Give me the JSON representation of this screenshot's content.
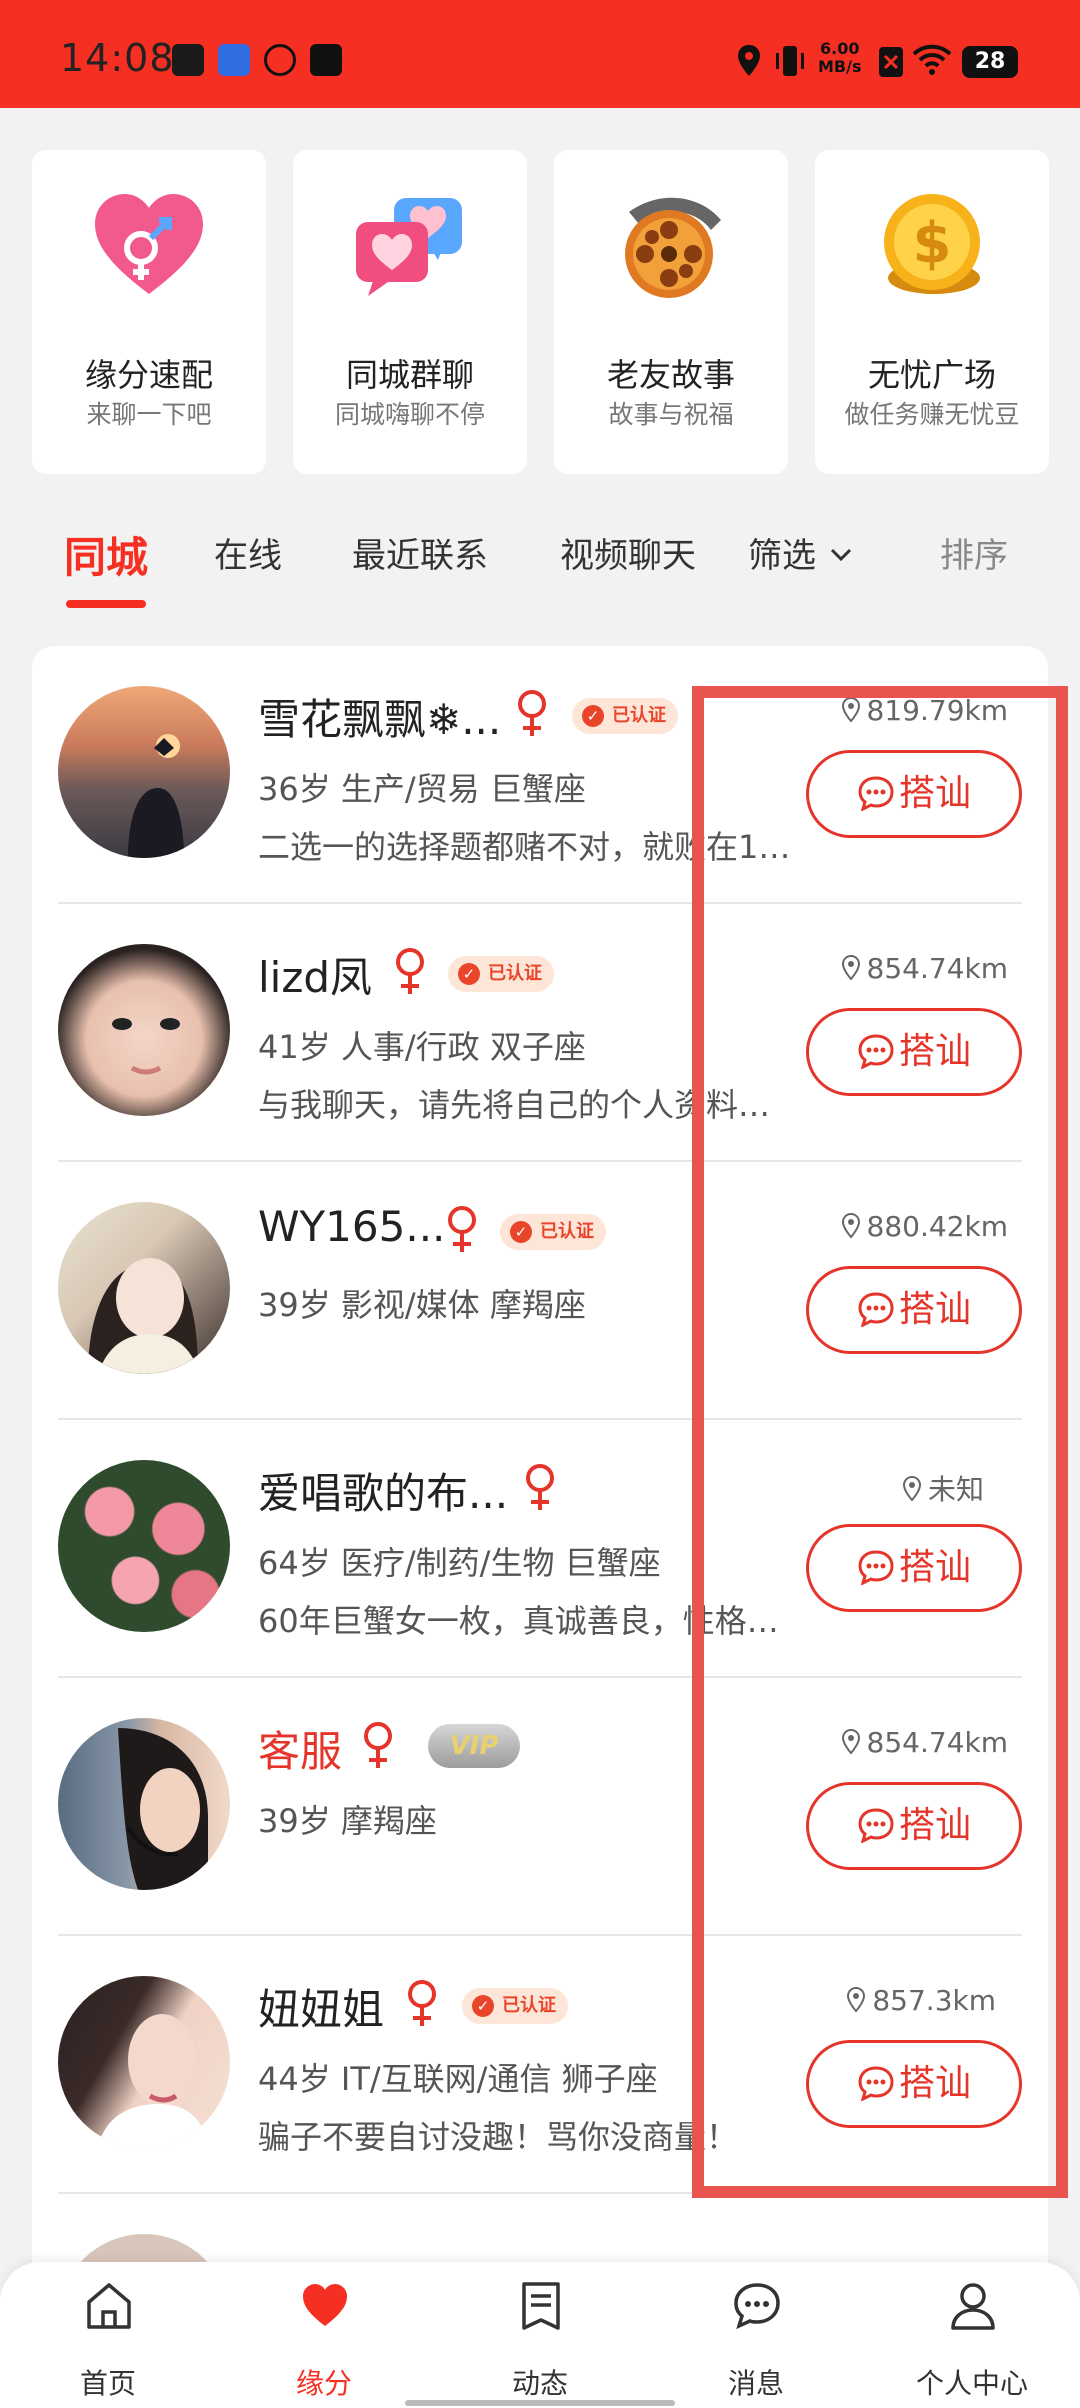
{
  "status_bar": {
    "time": "14:08",
    "speed_value": "6.00",
    "speed_unit": "MB/s",
    "battery": "28"
  },
  "features": [
    {
      "title": "缘分速配",
      "subtitle": "来聊一下吧",
      "icon": "heart-gender-icon"
    },
    {
      "title": "同城群聊",
      "subtitle": "同城嗨聊不停",
      "icon": "chat-bubbles-icon"
    },
    {
      "title": "老友故事",
      "subtitle": "故事与祝福",
      "icon": "film-reel-icon"
    },
    {
      "title": "无忧广场",
      "subtitle": "做任务赚无忧豆",
      "icon": "gold-coin-icon"
    }
  ],
  "tabs": {
    "local": "同城",
    "online": "在线",
    "recent": "最近联系",
    "video": "视频聊天",
    "filter": "筛选",
    "sort": "排序"
  },
  "users": [
    {
      "name": "雪花飘飘❄...",
      "verified": "已认证",
      "info": "36岁 生产/贸易 巨蟹座",
      "bio": "二选一的选择题都赌不对，就败在1…",
      "distance": "819.79km",
      "action": "搭讪"
    },
    {
      "name": "lizd凤",
      "verified": "已认证",
      "info": "41岁 人事/行政 双子座",
      "bio": "与我聊天，请先将自己的个人资料…",
      "distance": "854.74km",
      "action": "搭讪"
    },
    {
      "name": "WY165...",
      "verified": "已认证",
      "info": "39岁 影视/媒体 摩羯座",
      "bio": "",
      "distance": "880.42km",
      "action": "搭讪"
    },
    {
      "name": "爱唱歌的布...",
      "verified": "",
      "info": "64岁 医疗/制药/生物 巨蟹座",
      "bio": "60年巨蟹女一枚，真诚善良，性格…",
      "distance": "未知",
      "action": "搭讪"
    },
    {
      "name": "客服",
      "vip": "VIP",
      "info": "39岁   摩羯座",
      "bio": "",
      "distance": "854.74km",
      "action": "搭讪"
    },
    {
      "name": "妞妞姐",
      "verified": "已认证",
      "info": "44岁 IT/互联网/通信 狮子座",
      "bio": "骗子不要自讨没趣！骂你没商量！",
      "distance": "857.3km",
      "action": "搭讪"
    }
  ],
  "nav": [
    {
      "label": "首页",
      "icon": "home-icon"
    },
    {
      "label": "缘分",
      "icon": "heart-icon"
    },
    {
      "label": "动态",
      "icon": "document-icon"
    },
    {
      "label": "消息",
      "icon": "message-icon"
    },
    {
      "label": "个人中心",
      "icon": "person-icon"
    }
  ],
  "colors": {
    "brand": "#f52f22",
    "highlight": "#e9544e"
  }
}
